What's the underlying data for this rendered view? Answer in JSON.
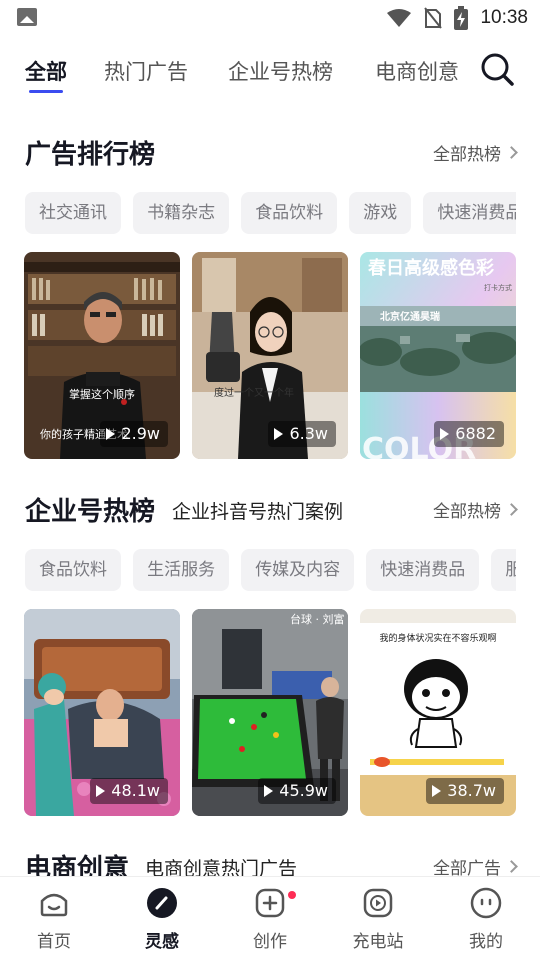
{
  "status_bar": {
    "time": "10:38"
  },
  "top_tabs": [
    {
      "label": "全部",
      "active": true
    },
    {
      "label": "热门广告"
    },
    {
      "label": "企业号热榜"
    },
    {
      "label": "电商创意"
    }
  ],
  "ad_ranking": {
    "title": "广告排行榜",
    "more": "全部热榜",
    "chips": [
      "社交通讯",
      "书籍杂志",
      "食品饮料",
      "游戏",
      "快速消费品"
    ],
    "cards": [
      {
        "views": "2.9w",
        "caption": "掌握这个顺序 你的孩子精通艺术"
      },
      {
        "views": "6.3w",
        "caption": "度过一个又一个年"
      },
      {
        "views": "6882",
        "title_text": "春日高级感色彩",
        "subtitle_text": "打卡方式",
        "company": "北京亿通昊瑞",
        "brand": "COLOR"
      }
    ]
  },
  "enterprise_ranking": {
    "title": "企业号热榜",
    "subtitle": "企业抖音号热门案例",
    "more": "全部热榜",
    "chips": [
      "食品饮料",
      "生活服务",
      "传媒及内容",
      "快速消费品",
      "服"
    ],
    "cards": [
      {
        "views": "48.1w"
      },
      {
        "views": "45.9w",
        "sign": "台球 · 刘富"
      },
      {
        "views": "38.7w",
        "caption": "我的身体状况实在不容乐观啊"
      }
    ]
  },
  "ecommerce": {
    "title": "电商创意",
    "subtitle": "电商创意热门广告",
    "more": "全部广告"
  },
  "bottom_nav": [
    {
      "label": "首页"
    },
    {
      "label": "灵感",
      "active": true
    },
    {
      "label": "创作",
      "badge": true
    },
    {
      "label": "充电站"
    },
    {
      "label": "我的"
    }
  ],
  "colors": {
    "accent": "#3b4cf0",
    "badge": "#fe2c55"
  }
}
